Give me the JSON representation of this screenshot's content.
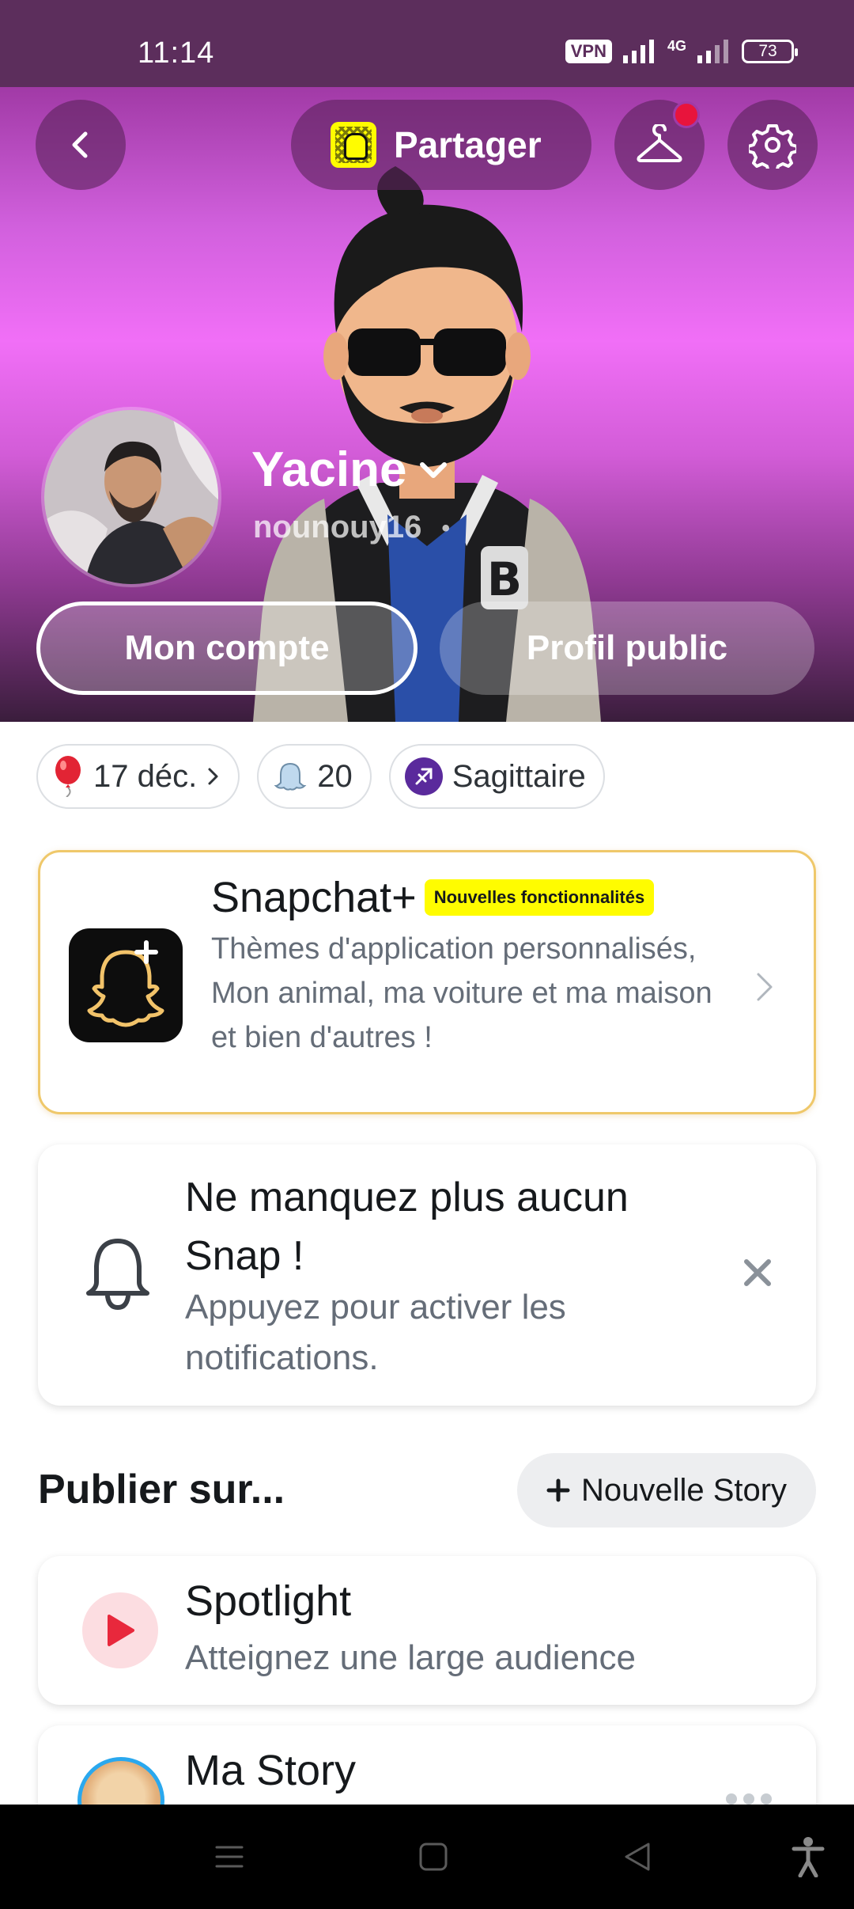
{
  "status_bar": {
    "time": "11:14",
    "vpn": "VPN",
    "network": "4G",
    "battery": "73"
  },
  "header": {
    "share_label": "Partager",
    "display_name": "Yacine",
    "username": "nounouy16",
    "buttons": {
      "account": "Mon compte",
      "public_profile": "Profil public"
    },
    "notification_dot_color": "#e8143c"
  },
  "chips": {
    "birthday": "17 déc.",
    "friends_count": "20",
    "zodiac": "Sagittaire"
  },
  "snapchat_plus": {
    "title": "Snapchat+",
    "badge": "Nouvelles fonctionnalités",
    "description": "Thèmes d'application personnalisés, Mon animal, ma voiture et ma maison et bien d'autres !"
  },
  "notifications_card": {
    "title": "Ne manquez plus aucun Snap !",
    "description": "Appuyez pour activer les notifications."
  },
  "publish": {
    "section_title": "Publier sur...",
    "new_story_label": "Nouvelle Story",
    "spotlight": {
      "title": "Spotlight",
      "subtitle": "Atteignez une large audience"
    },
    "my_story": {
      "title": "Ma Story"
    }
  },
  "colors": {
    "brand_yellow": "#fffc00",
    "spotlight_red": "#e8283c",
    "header_purple": "#f16ff7"
  }
}
